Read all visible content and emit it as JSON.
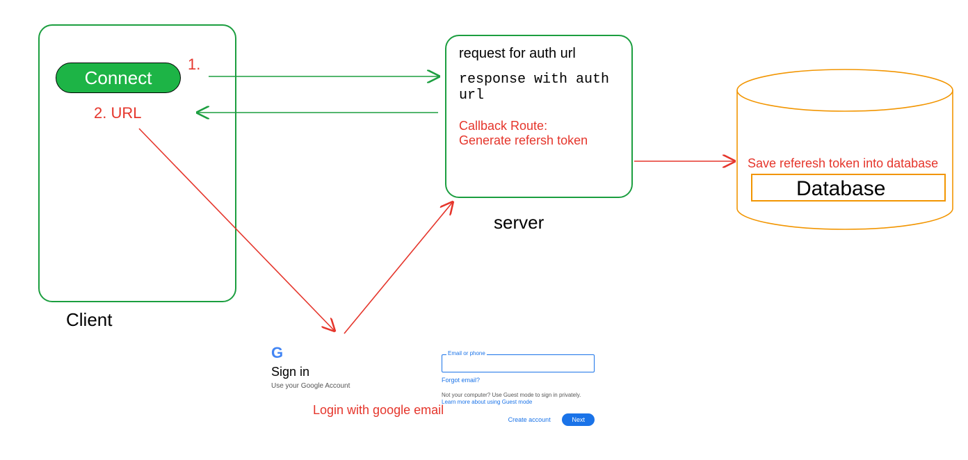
{
  "client": {
    "label": "Client",
    "connect_button": "Connect",
    "step1": "1.",
    "step2": "2. URL"
  },
  "server": {
    "label": "server",
    "request_line": "request for auth url",
    "response_line": "response with auth url",
    "callback_title": "Callback Route:",
    "callback_action": "Generate refersh token"
  },
  "database": {
    "label": "Database",
    "save_text": "Save referesh token into database"
  },
  "google": {
    "signin": "Sign in",
    "subtitle": "Use your Google Account",
    "field_label": "Email or phone",
    "forgot": "Forgot email?",
    "note1": "Not your computer? Use Guest mode to sign in privately.",
    "note2": "Learn more about using Guest mode",
    "create": "Create account",
    "next": "Next",
    "caption": "Login with google email"
  }
}
